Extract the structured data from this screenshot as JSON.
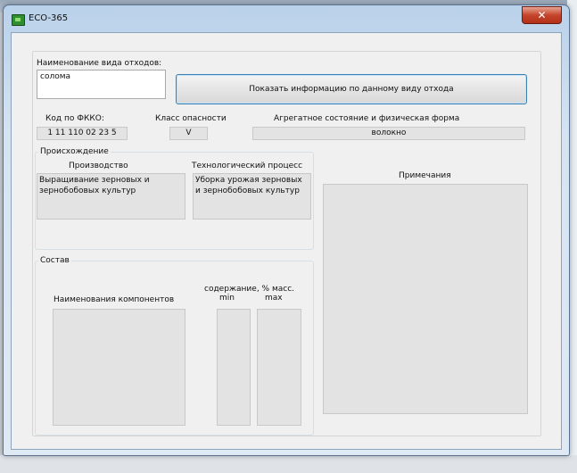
{
  "window": {
    "title": "ECO-365",
    "close_glyph": "✕"
  },
  "waste": {
    "name_label": "Наименование вида отходов:",
    "name_value": "солома",
    "show_info_button": "Показать информацию по данному виду отхода"
  },
  "classification": {
    "fkko_label": "Код по ФККО:",
    "fkko_value": "1 11 110 02 23 5",
    "hazard_label": "Класс опасности",
    "hazard_value": "V",
    "state_label": "Агрегатное состояние и физическая форма",
    "state_value": "волокно"
  },
  "origin": {
    "group_label": "Происхождение",
    "production_label": "Производство",
    "production_value": "Выращивание зерновых и зернобобовых культур",
    "process_label": "Технологический процесс",
    "process_value": "Уборка урожая зерновых и зернобобовых культур"
  },
  "notes": {
    "label": "Примечания",
    "value": ""
  },
  "composition": {
    "group_label": "Состав",
    "components_label": "Наименования компонентов",
    "content_label": "содержание, % масс.",
    "min_label": "min",
    "max_label": "max",
    "components": [],
    "min_values": [],
    "max_values": []
  }
}
